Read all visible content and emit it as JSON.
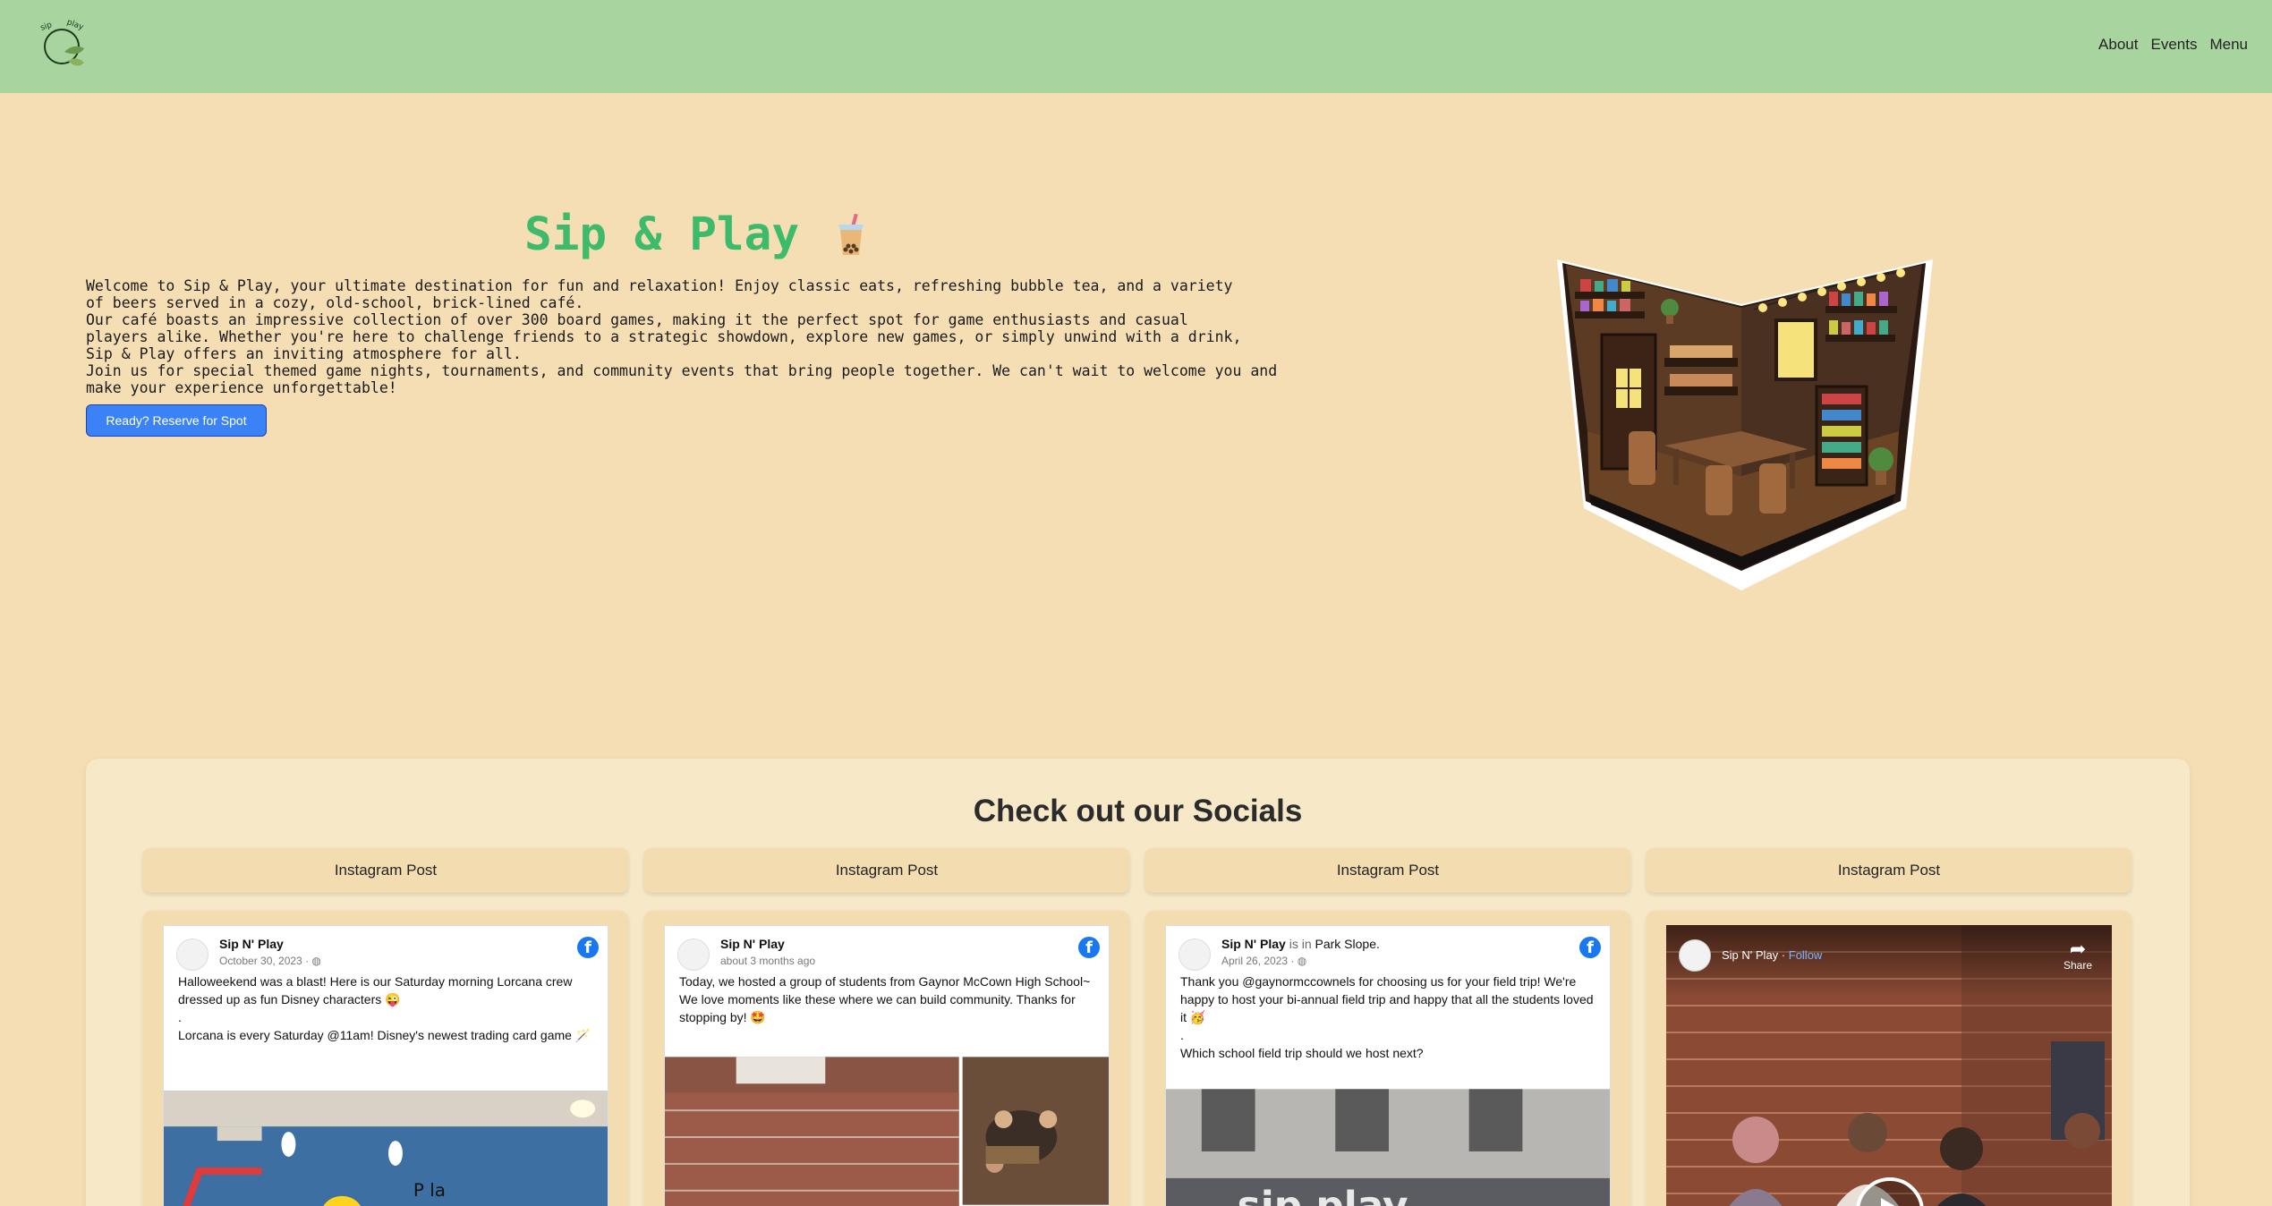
{
  "header": {
    "nav": [
      "About",
      "Events",
      "Menu"
    ]
  },
  "hero": {
    "title": "Sip & Play",
    "paragraphs": [
      "Welcome to Sip & Play, your ultimate destination for fun and relaxation! Enjoy classic eats, refreshing bubble tea, and a variety of beers served in a cozy, old-school, brick-lined café.",
      "Our café boasts an impressive collection of over 300 board games, making it the perfect spot for game enthusiasts and casual players alike. Whether you're here to challenge friends to a strategic showdown, explore new games, or simply unwind with a drink, Sip & Play offers an inviting atmosphere for all.",
      "Join us for special themed game nights, tournaments, and community events that bring people together. We can't wait to welcome you and make your experience unforgettable!"
    ],
    "button": "Ready? Reserve for Spot"
  },
  "socials": {
    "title": "Check out our Socials",
    "tabs": [
      "Instagram Post",
      "Instagram Post",
      "Instagram Post",
      "Instagram Post"
    ],
    "posts": [
      {
        "name": "Sip N' Play",
        "date": "October 30, 2023 · ",
        "lines": [
          "Halloweekend was a blast! Here is our Saturday morning Lorcana crew dressed up as fun Disney characters 😜",
          ".",
          "Lorcana is every Saturday @11am! Disney's newest trading card game 🪄"
        ]
      },
      {
        "name": "Sip N' Play",
        "date": "about 3 months ago",
        "lines": [
          "Today, we hosted a group of students from Gaynor McCown High School~ We love moments like these where we can build community. Thanks for stopping by! 🤩"
        ]
      },
      {
        "name": "Sip N' Play",
        "name_suffix": " is in ",
        "place": "Park Slope.",
        "date": "April 26, 2023 · ",
        "lines": [
          "Thank you @gaynormccownels for choosing us for your field trip! We're happy to host your bi-annual field trip and happy that all the students loved it 🥳",
          ".",
          "Which school field trip should we host next?"
        ]
      }
    ],
    "video": {
      "name": "Sip N' Play",
      "follow": "Follow",
      "share": "Share"
    }
  }
}
